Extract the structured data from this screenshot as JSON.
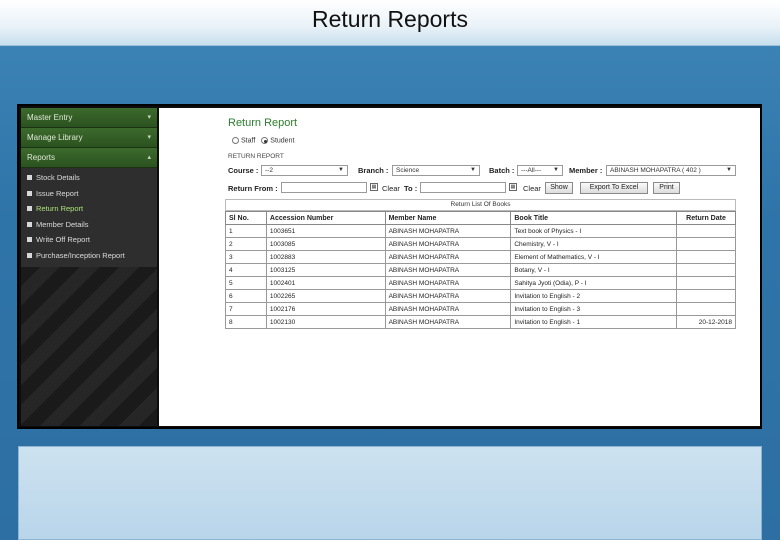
{
  "slide": {
    "title": "Return Reports"
  },
  "sidebar": {
    "items": [
      {
        "label": "Master Entry",
        "arrow": "▾"
      },
      {
        "label": "Manage Library",
        "arrow": "▾"
      },
      {
        "label": "Reports",
        "arrow": "▴"
      }
    ],
    "report_items": [
      {
        "label": "Stock Details"
      },
      {
        "label": "Issue Report"
      },
      {
        "label": "Return Report"
      },
      {
        "label": "Member Details"
      },
      {
        "label": "Write Off Report"
      },
      {
        "label": "Purchase/Inception Report"
      }
    ]
  },
  "form": {
    "page_title": "Return Report",
    "radio_staff": "Staff",
    "radio_student": "Student",
    "section_label": "RETURN REPORT",
    "course_label": "Course :",
    "course_value": "--2",
    "branch_label": "Branch :",
    "branch_value": "Science",
    "batch_label": "Batch :",
    "batch_value": "---All---",
    "member_label": "Member :",
    "member_value": "ABINASH MOHAPATRA ( 402 )",
    "return_from_label": "Return From :",
    "clear1": "Clear",
    "to_label": "To :",
    "clear2": "Clear",
    "show_button": "Show",
    "export_button": "Export To Excel",
    "print_button": "Print"
  },
  "table": {
    "caption": "Return List Of Books",
    "headers": [
      "Sl No.",
      "Accession Number",
      "Member Name",
      "Book Title",
      "Return Date"
    ],
    "rows": [
      [
        "1",
        "1003651",
        "ABINASH MOHAPATRA",
        "Text book of Physics - I",
        ""
      ],
      [
        "2",
        "1003085",
        "ABINASH MOHAPATRA",
        "Chemistry, V - I",
        ""
      ],
      [
        "3",
        "1002883",
        "ABINASH MOHAPATRA",
        "Element of Mathematics, V - I",
        ""
      ],
      [
        "4",
        "1003125",
        "ABINASH MOHAPATRA",
        "Botany, V - I",
        ""
      ],
      [
        "5",
        "1002401",
        "ABINASH MOHAPATRA",
        "Sahitya Jyoti (Odia), P - I",
        ""
      ],
      [
        "6",
        "1002265",
        "ABINASH MOHAPATRA",
        "Invitation to English - 2",
        ""
      ],
      [
        "7",
        "1002176",
        "ABINASH MOHAPATRA",
        "Invitation to English - 3",
        ""
      ],
      [
        "8",
        "1002130",
        "ABINASH MOHAPATRA",
        "Invitation to English - 1",
        "20-12-2018"
      ]
    ]
  }
}
